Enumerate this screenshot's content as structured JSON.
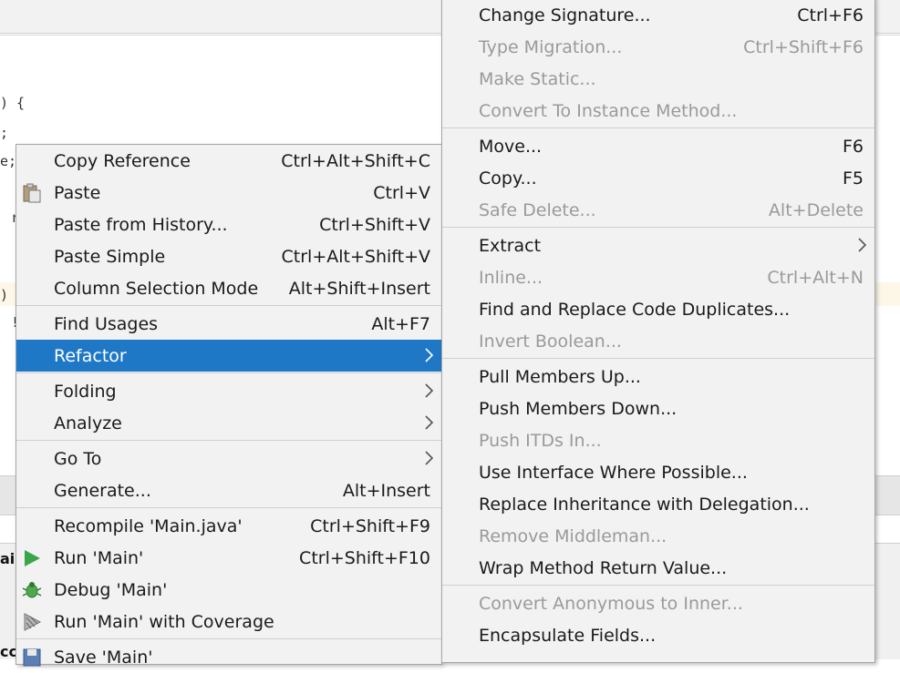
{
  "editor": {
    "code_fragments": [
      ") {",
      ";",
      "e;",
      "r",
      ")",
      "!"
    ],
    "bottom_fragments": [
      "ai",
      "cc"
    ]
  },
  "context_menu": {
    "items": [
      {
        "label": "Copy Reference",
        "shortcut": "Ctrl+Alt+Shift+C",
        "icon": "",
        "enabled": true
      },
      {
        "label": "Paste",
        "shortcut": "Ctrl+V",
        "icon": "clipboard-icon",
        "enabled": true
      },
      {
        "label": "Paste from History...",
        "shortcut": "Ctrl+Shift+V",
        "icon": "",
        "enabled": true
      },
      {
        "label": "Paste Simple",
        "shortcut": "Ctrl+Alt+Shift+V",
        "icon": "",
        "enabled": true
      },
      {
        "label": "Column Selection Mode",
        "shortcut": "Alt+Shift+Insert",
        "icon": "",
        "enabled": true
      },
      {
        "label": "Find Usages",
        "shortcut": "Alt+F7",
        "icon": "",
        "enabled": true
      },
      {
        "label": "Refactor",
        "shortcut": "",
        "icon": "chevron-right-icon",
        "enabled": true,
        "selected": true
      },
      {
        "label": "Folding",
        "shortcut": "",
        "icon": "chevron-right-icon",
        "enabled": true
      },
      {
        "label": "Analyze",
        "shortcut": "",
        "icon": "chevron-right-icon",
        "enabled": true
      },
      {
        "label": "Go To",
        "shortcut": "",
        "icon": "chevron-right-icon",
        "enabled": true
      },
      {
        "label": "Generate...",
        "shortcut": "Alt+Insert",
        "icon": "",
        "enabled": true
      },
      {
        "label": "Recompile 'Main.java'",
        "shortcut": "Ctrl+Shift+F9",
        "icon": "",
        "enabled": true
      },
      {
        "label": "Run 'Main'",
        "shortcut": "Ctrl+Shift+F10",
        "icon": "run-icon",
        "enabled": true
      },
      {
        "label": "Debug 'Main'",
        "shortcut": "",
        "icon": "debug-icon",
        "enabled": true
      },
      {
        "label": "Run 'Main' with Coverage",
        "shortcut": "",
        "icon": "coverage-icon",
        "enabled": true
      },
      {
        "label": "Save 'Main'",
        "shortcut": "",
        "icon": "save-icon",
        "enabled": true
      }
    ]
  },
  "refactor_menu": {
    "items": [
      {
        "label": "Change Signature...",
        "shortcut": "Ctrl+F6",
        "enabled": true
      },
      {
        "label": "Type Migration...",
        "shortcut": "Ctrl+Shift+F6",
        "enabled": false
      },
      {
        "label": "Make Static...",
        "shortcut": "",
        "enabled": false
      },
      {
        "label": "Convert To Instance Method...",
        "shortcut": "",
        "enabled": false
      },
      {
        "label": "Move...",
        "shortcut": "F6",
        "enabled": true
      },
      {
        "label": "Copy...",
        "shortcut": "F5",
        "enabled": true
      },
      {
        "label": "Safe Delete...",
        "shortcut": "Alt+Delete",
        "enabled": false
      },
      {
        "label": "Extract",
        "shortcut": "",
        "enabled": true,
        "submenu": true
      },
      {
        "label": "Inline...",
        "shortcut": "Ctrl+Alt+N",
        "enabled": false
      },
      {
        "label": "Find and Replace Code Duplicates...",
        "shortcut": "",
        "enabled": true
      },
      {
        "label": "Invert Boolean...",
        "shortcut": "",
        "enabled": false
      },
      {
        "label": "Pull Members Up...",
        "shortcut": "",
        "enabled": true
      },
      {
        "label": "Push Members Down...",
        "shortcut": "",
        "enabled": true
      },
      {
        "label": "Push ITDs In...",
        "shortcut": "",
        "enabled": false
      },
      {
        "label": "Use Interface Where Possible...",
        "shortcut": "",
        "enabled": true
      },
      {
        "label": "Replace Inheritance with Delegation...",
        "shortcut": "",
        "enabled": true
      },
      {
        "label": "Remove Middleman...",
        "shortcut": "",
        "enabled": false
      },
      {
        "label": "Wrap Method Return Value...",
        "shortcut": "",
        "enabled": true
      },
      {
        "label": "Convert Anonymous to Inner...",
        "shortcut": "",
        "enabled": false
      },
      {
        "label": "Encapsulate Fields...",
        "shortcut": "",
        "enabled": true
      }
    ]
  },
  "colors": {
    "menu_bg": "#f2f2f2",
    "selection": "#1e78c6",
    "disabled_text": "#9a9a9a",
    "run_green": "#3aa64a"
  }
}
